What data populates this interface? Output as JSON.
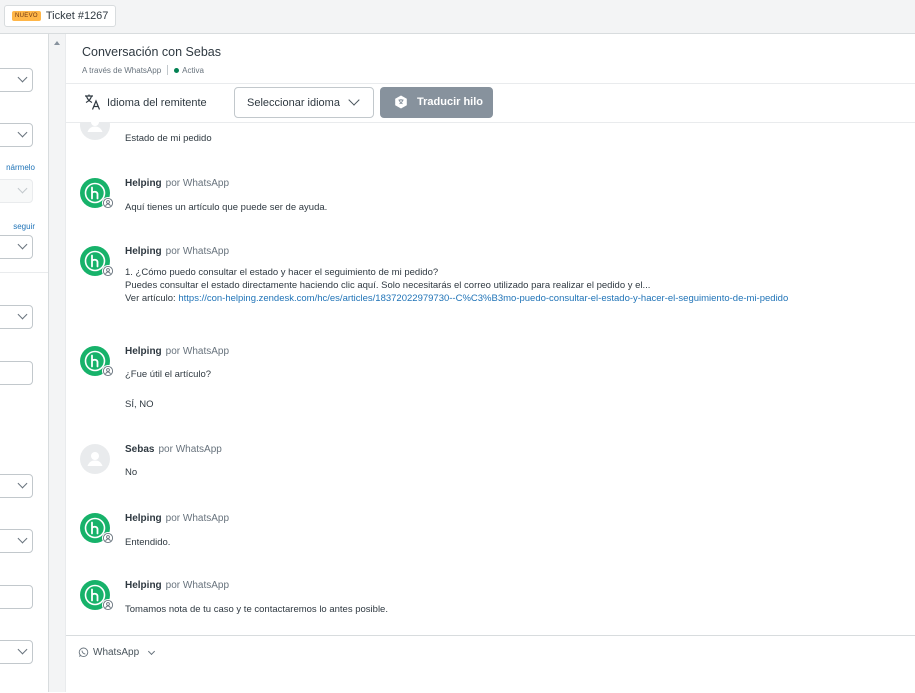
{
  "tab": {
    "badge": "NUEVO",
    "title": "Ticket #1267"
  },
  "left_panel": {
    "link1": "nármelo",
    "link2": "seguir"
  },
  "conversation": {
    "title": "Conversación con Sebas",
    "channel": "A través de WhatsApp",
    "status": "Activa",
    "status_color": "#038153"
  },
  "translate": {
    "sender_lang_label": "Idioma del remitente",
    "select_placeholder": "Seleccionar idioma",
    "button": "Traducir hilo"
  },
  "messages": [
    {
      "sender": "",
      "via": "",
      "lines": [
        "Estado de mi pedido"
      ]
    },
    {
      "sender": "Helping",
      "via": "por WhatsApp",
      "lines": [
        "Aquí tienes un artículo que puede ser de ayuda."
      ]
    },
    {
      "sender": "Helping",
      "via": "por WhatsApp",
      "lines": [
        "1. ¿Cómo puedo consultar el estado y hacer el seguimiento de mi pedido?",
        "Puedes consultar el estado directamente haciendo clic aquí. Solo necesitarás el correo utilizado para realizar el pedido y el..."
      ],
      "link_prefix": "Ver artículo: ",
      "link": "https://con-helping.zendesk.com/hc/es/articles/18372022979730--C%C3%B3mo-puedo-consultar-el-estado-y-hacer-el-seguimiento-de-mi-pedido"
    },
    {
      "sender": "Helping",
      "via": "por WhatsApp",
      "lines": [
        "¿Fue útil el artículo?",
        "SÍ, NO"
      ]
    },
    {
      "sender": "Sebas",
      "via": "por WhatsApp",
      "lines": [
        "No"
      ]
    },
    {
      "sender": "Helping",
      "via": "por WhatsApp",
      "lines": [
        "Entendido."
      ]
    },
    {
      "sender": "Helping",
      "via": "por WhatsApp",
      "lines": [
        "Tomamos nota de tu caso y te contactaremos lo antes posible."
      ]
    }
  ],
  "composer": {
    "channel": "WhatsApp"
  },
  "colors": {
    "bot_avatar": "#17b26a",
    "link": "#1f73b7",
    "translate_button": "#87929d"
  }
}
